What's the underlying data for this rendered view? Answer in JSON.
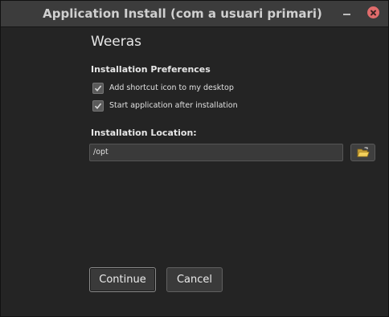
{
  "window": {
    "title": "Application Install (com a usuari primari)"
  },
  "app": {
    "name": "Weeras"
  },
  "preferences": {
    "heading": "Installation Preferences",
    "options": [
      {
        "label": "Add shortcut icon to my desktop",
        "checked": true
      },
      {
        "label": "Start application after installation",
        "checked": true
      }
    ]
  },
  "location": {
    "heading": "Installation Location:",
    "path": "/opt",
    "browse_icon": "folder-open-icon"
  },
  "actions": {
    "continue_label": "Continue",
    "cancel_label": "Cancel"
  },
  "colors": {
    "background": "#242424",
    "titlebar": "#3c3c3c",
    "close": "#e06c6c"
  }
}
